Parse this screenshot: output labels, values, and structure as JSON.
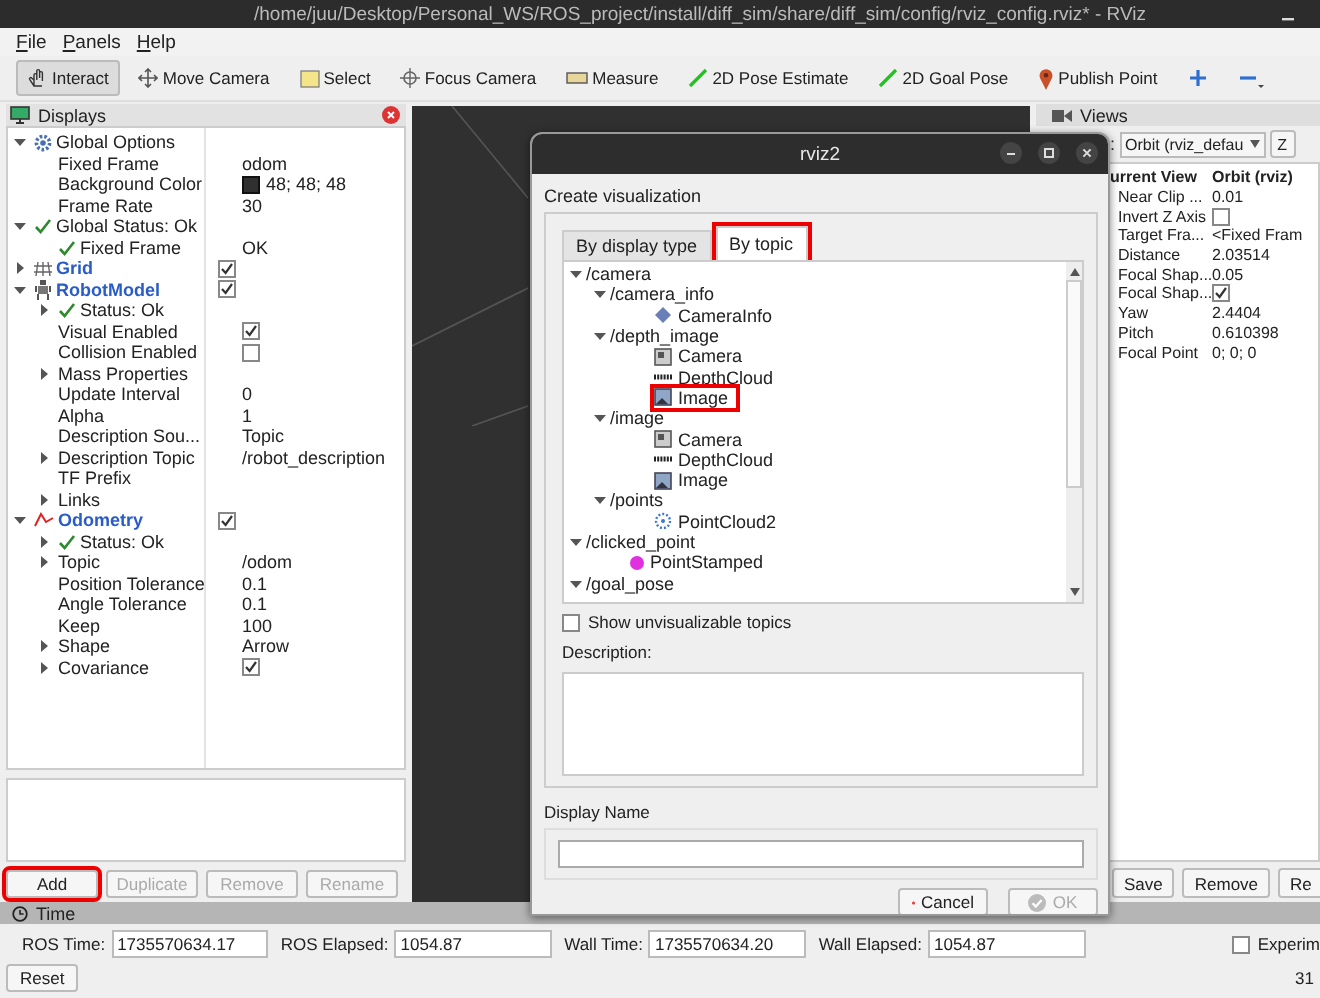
{
  "window": {
    "title": "/home/juu/Desktop/Personal_WS/ROS_project/install/diff_sim/share/diff_sim/config/rviz_config.rviz* - RViz"
  },
  "menu": [
    "File",
    "Panels",
    "Help"
  ],
  "toolbar": [
    {
      "kind": "hand",
      "label": "Interact",
      "selected": true
    },
    {
      "kind": "move",
      "label": "Move Camera",
      "selected": false
    },
    {
      "kind": "select",
      "label": "Select",
      "selected": false
    },
    {
      "kind": "focus",
      "label": "Focus Camera",
      "selected": false
    },
    {
      "kind": "ruler",
      "label": "Measure",
      "selected": false
    },
    {
      "kind": "pose",
      "label": "2D Pose Estimate",
      "selected": false
    },
    {
      "kind": "pose",
      "label": "2D Goal Pose",
      "selected": false
    },
    {
      "kind": "pin",
      "label": "Publish Point",
      "selected": false
    },
    {
      "kind": "add",
      "selected": false
    },
    {
      "kind": "remove",
      "selected": false
    }
  ],
  "displays": {
    "title": "Displays",
    "tree": [
      {
        "kind": "options",
        "label": "Global Options",
        "expanded": true,
        "children": [
          {
            "kind": "property",
            "label": "Fixed Frame",
            "value": "odom"
          },
          {
            "kind": "property",
            "label": "Background Color",
            "color": "#303030",
            "value": "48; 48; 48"
          },
          {
            "kind": "property",
            "label": "Frame Rate",
            "value": "30"
          }
        ]
      },
      {
        "kind": "status",
        "label": "Global Status: Ok",
        "expanded": true,
        "children": [
          {
            "kind": "status",
            "label": "Fixed Frame",
            "value": "OK"
          }
        ]
      },
      {
        "kind": "grid",
        "label": "Grid",
        "expanded": false,
        "checked": true
      },
      {
        "kind": "robot",
        "label": "RobotModel",
        "expanded": true,
        "checked": true,
        "children": [
          {
            "kind": "status",
            "label": "Status: Ok",
            "expanded": false
          },
          {
            "kind": "property",
            "label": "Visual Enabled",
            "checked": true
          },
          {
            "kind": "property",
            "label": "Collision Enabled",
            "checked": false
          },
          {
            "kind": "property",
            "label": "Mass Properties",
            "expanded": false
          },
          {
            "kind": "property",
            "label": "Update Interval",
            "value": "0"
          },
          {
            "kind": "property",
            "label": "Alpha",
            "value": "1"
          },
          {
            "kind": "property",
            "label": "Description Sou...",
            "value": "Topic"
          },
          {
            "kind": "property",
            "label": "Description Topic",
            "expanded": false,
            "value": "/robot_description"
          },
          {
            "kind": "property",
            "label": "TF Prefix"
          },
          {
            "kind": "property",
            "label": "Links",
            "expanded": false
          }
        ]
      },
      {
        "kind": "odometry",
        "label": "Odometry",
        "expanded": true,
        "checked": true,
        "children": [
          {
            "kind": "status",
            "label": "Status: Ok",
            "expanded": false
          },
          {
            "kind": "property",
            "label": "Topic",
            "expanded": false,
            "value": "/odom"
          },
          {
            "kind": "property",
            "label": "Position Tolerance",
            "value": "0.1"
          },
          {
            "kind": "property",
            "label": "Angle Tolerance",
            "value": "0.1"
          },
          {
            "kind": "property",
            "label": "Keep",
            "value": "100"
          },
          {
            "kind": "property",
            "label": "Shape",
            "expanded": false,
            "value": "Arrow"
          },
          {
            "kind": "property",
            "label": "Covariance",
            "expanded": false,
            "checked": true
          }
        ]
      }
    ],
    "buttons": [
      {
        "label": "Add",
        "disabled": false,
        "highlighted": true
      },
      {
        "label": "Duplicate",
        "disabled": true,
        "highlighted": false
      },
      {
        "label": "Remove",
        "disabled": true,
        "highlighted": false
      },
      {
        "label": "Rename",
        "disabled": true,
        "highlighted": false
      }
    ]
  },
  "views": {
    "title": "Views",
    "type_label": ":",
    "type_value": "Orbit (rviz_defau",
    "zero_button": "Z",
    "header": [
      "urrent View",
      "Orbit (rviz)"
    ],
    "rows": [
      {
        "label": "Near Clip ...",
        "value": "0.01"
      },
      {
        "label": "Invert Z Axis",
        "checked": false
      },
      {
        "label": "Target Fra...",
        "value": "<Fixed Fram"
      },
      {
        "label": "Distance",
        "value": "2.03514"
      },
      {
        "label": "Focal Shap...",
        "value": "0.05"
      },
      {
        "label": "Focal Shap...",
        "checked": true
      },
      {
        "label": "Yaw",
        "value": "2.4404"
      },
      {
        "label": "Pitch",
        "value": "0.610398"
      },
      {
        "label": "Focal Point",
        "value": "0; 0; 0"
      }
    ],
    "buttons": [
      "Save",
      "Remove",
      "Re"
    ]
  },
  "time": {
    "title": "Time",
    "fields": [
      {
        "label": "ROS Time:",
        "value": "1735570634.17"
      },
      {
        "label": "ROS Elapsed:",
        "value": "1054.87"
      },
      {
        "label": "Wall Time:",
        "value": "1735570634.20"
      },
      {
        "label": "Wall Elapsed:",
        "value": "1054.87"
      }
    ],
    "experimental": {
      "label": "Experim",
      "checked": false
    },
    "reset": "Reset",
    "status": "31"
  },
  "dialog": {
    "title": "rviz2",
    "group_title": "Create visualization",
    "tabs": [
      {
        "label": "By display type",
        "selected": false,
        "highlighted": false
      },
      {
        "label": "By topic",
        "selected": true,
        "highlighted": true
      }
    ],
    "topics": [
      {
        "label": "/camera",
        "expanded": true,
        "highlighted": false,
        "children": [
          {
            "label": "/camera_info",
            "expanded": true,
            "highlighted": false,
            "children": [
              {
                "kind": "camerainfo",
                "label": "CameraInfo",
                "highlighted": false
              }
            ]
          },
          {
            "label": "/depth_image",
            "expanded": true,
            "highlighted": false,
            "children": [
              {
                "kind": "camera",
                "label": "Camera",
                "highlighted": false
              },
              {
                "kind": "depthcloud",
                "label": "DepthCloud",
                "highlighted": false
              },
              {
                "kind": "image",
                "label": "Image",
                "highlighted": true
              }
            ]
          },
          {
            "label": "/image",
            "expanded": true,
            "highlighted": false,
            "children": [
              {
                "kind": "camera",
                "label": "Camera",
                "highlighted": false
              },
              {
                "kind": "depthcloud",
                "label": "DepthCloud",
                "highlighted": false
              },
              {
                "kind": "image",
                "label": "Image",
                "highlighted": false
              }
            ]
          },
          {
            "label": "/points",
            "expanded": true,
            "highlighted": false,
            "children": [
              {
                "kind": "pointcloud",
                "label": "PointCloud2",
                "highlighted": false
              }
            ]
          }
        ]
      },
      {
        "label": "/clicked_point",
        "expanded": true,
        "highlighted": false,
        "children": [
          {
            "kind": "point",
            "label": "PointStamped",
            "highlighted": false
          }
        ]
      },
      {
        "label": "/goal_pose",
        "expanded": true,
        "highlighted": false
      }
    ],
    "show_unvisualizable": {
      "label": "Show unvisualizable topics",
      "checked": false
    },
    "description_label": "Description:",
    "name_label": "Display Name",
    "buttons": [
      {
        "kind": "cancel",
        "label": "Cancel",
        "disabled": false
      },
      {
        "kind": "ok",
        "label": "OK",
        "disabled": true
      }
    ]
  }
}
